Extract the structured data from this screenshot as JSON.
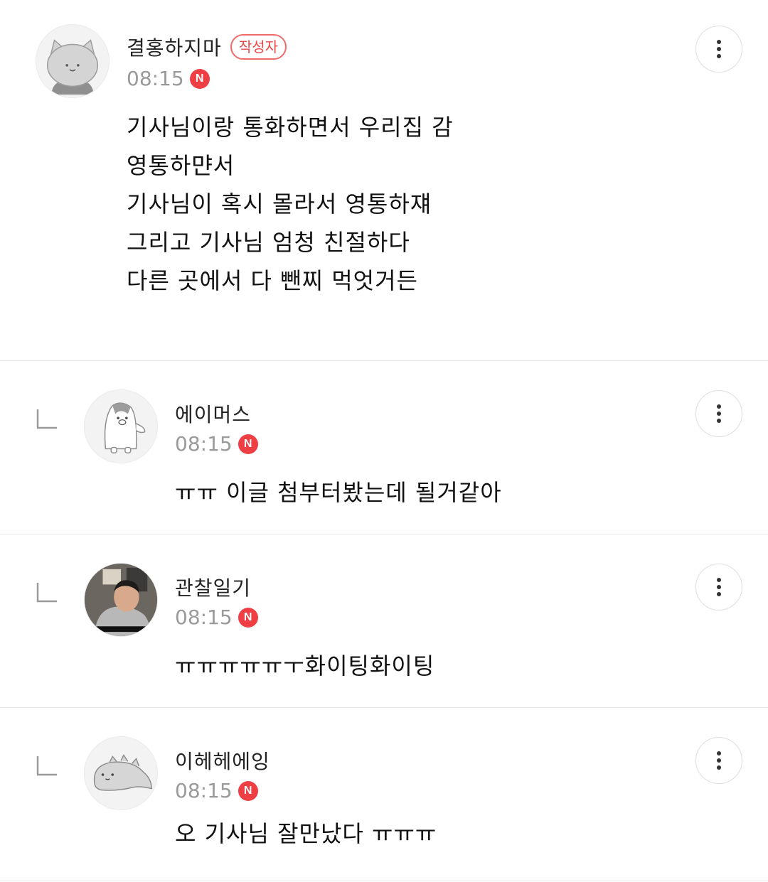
{
  "comments": [
    {
      "nickname": "결홍하지마",
      "author_badge": "작성자",
      "time": "08:15",
      "new_badge": "N",
      "body": "기사님이랑 통화하면서 우리집 감\n영통하먄서\n기사님이 혹시 몰라서 영통하쟤\n그리고 기사님 엄청 친절하다\n다른 곳에서 다 뺀찌 먹엇거든",
      "avatar_icon": "cat-avatar-icon"
    },
    {
      "nickname": "에이머스",
      "time": "08:15",
      "new_badge": "N",
      "body": "ㅠㅠ 이글 첨부터봤는데 될거같아",
      "avatar_icon": "penguin-avatar-icon"
    },
    {
      "nickname": "관찰일기",
      "time": "08:15",
      "new_badge": "N",
      "body": "ㅠㅠㅠㅠㅠㅜ화이팅화이팅",
      "avatar_icon": "photo-avatar-icon"
    },
    {
      "nickname": "이헤헤에잉",
      "time": "08:15",
      "new_badge": "N",
      "body": "오 기사님 잘만났다 ㅠㅠㅠ",
      "avatar_icon": "lizard-avatar-icon"
    }
  ],
  "colors": {
    "badge_red": "#ef3e44",
    "author_badge": "#e84a4a",
    "time_gray": "#9a9a9a",
    "divider": "#e6e6e6"
  },
  "icons": {
    "more": "more-vertical-icon",
    "reply": "reply-arrow-icon"
  }
}
